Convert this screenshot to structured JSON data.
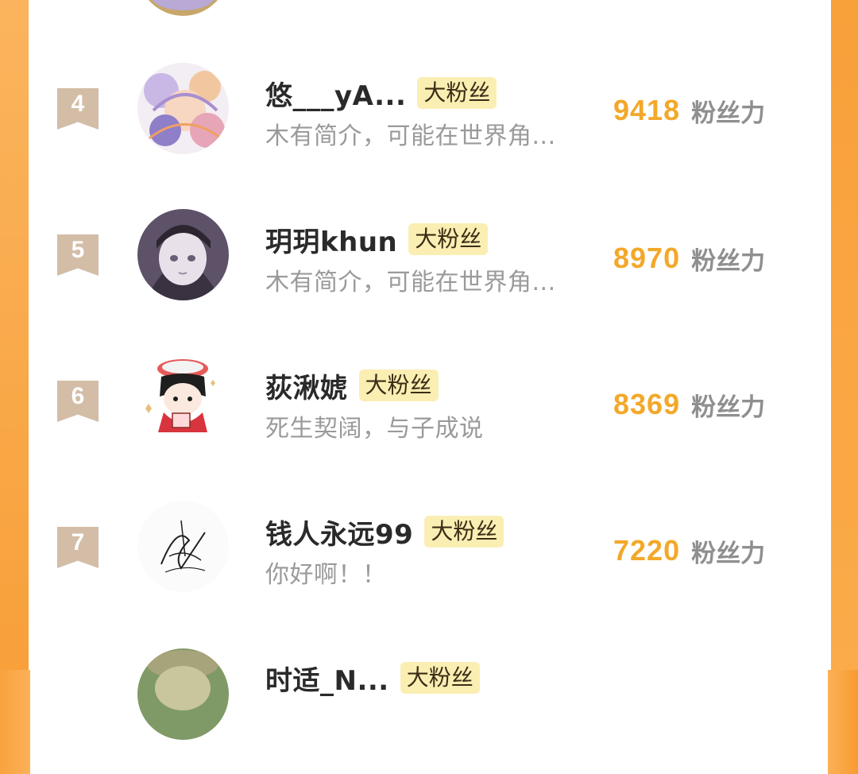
{
  "list": {
    "rows": [
      {
        "rank": "4",
        "name": "悠___yA...",
        "tag": "大粉丝",
        "bio": "木有简介，可能在世界角...",
        "score": "9418",
        "score_unit": "粉丝力"
      },
      {
        "rank": "5",
        "name": "玥玥khun",
        "tag": "大粉丝",
        "bio": "木有简介，可能在世界角...",
        "score": "8970",
        "score_unit": "粉丝力"
      },
      {
        "rank": "6",
        "name": "荻湫婋",
        "tag": "大粉丝",
        "bio": "死生契阔，与子成说",
        "score": "8369",
        "score_unit": "粉丝力"
      },
      {
        "rank": "7",
        "name": "钱人永远99",
        "tag": "大粉丝",
        "bio": "你好啊！！",
        "score": "7220",
        "score_unit": "粉丝力"
      },
      {
        "rank": "",
        "name": "时适_N...",
        "tag": "大粉丝",
        "bio": "",
        "score": "",
        "score_unit": ""
      }
    ]
  },
  "colors": {
    "accent_orange": "#f3a82a",
    "tag_background": "#fbeeb3",
    "rank_badge": "#d3bda7",
    "side_orange": "#f8a03a"
  },
  "icons": [
    "rank-badge-icon",
    "avatar"
  ]
}
